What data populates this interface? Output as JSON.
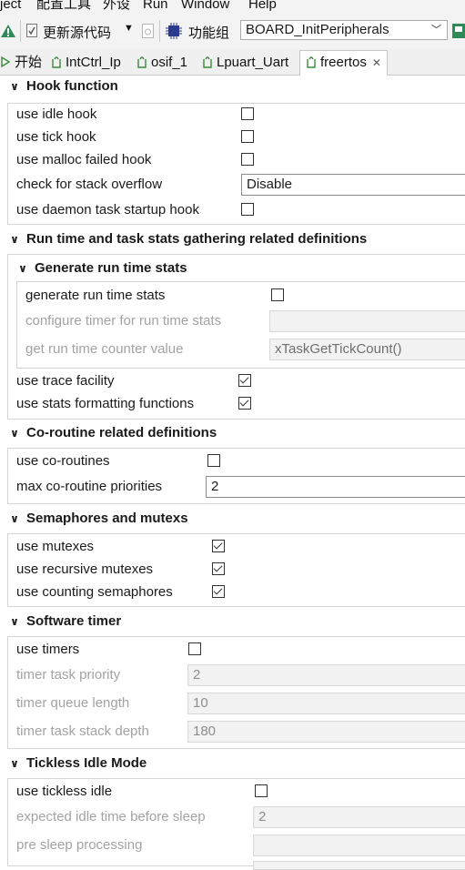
{
  "menubar": {
    "items": [
      "ject",
      "配置工具",
      "外设",
      "Run",
      "Window",
      "Help"
    ]
  },
  "toolbar": {
    "update_source": "更新源代码",
    "function_group": "功能组",
    "board_select": "BOARD_InitPeripherals"
  },
  "tabs": [
    {
      "label": "开始"
    },
    {
      "label": "IntCtrl_Ip"
    },
    {
      "label": "osif_1"
    },
    {
      "label": "Lpuart_Uart"
    },
    {
      "label": "freertos"
    }
  ],
  "sections": {
    "hook": {
      "title": "Hook function",
      "use_idle_hook": "use idle hook",
      "use_tick_hook": "use tick hook",
      "use_malloc_failed_hook": "use malloc failed hook",
      "check_stack_overflow": "check for stack overflow",
      "check_stack_overflow_value": "Disable",
      "use_daemon_hook": "use daemon task startup hook"
    },
    "runtime": {
      "title": "Run time and task stats gathering related definitions",
      "sub_title": "Generate run time stats",
      "generate_stats": "generate run time stats",
      "configure_timer": "configure timer for run time stats",
      "get_counter": "get run time counter value",
      "get_counter_value": "xTaskGetTickCount()",
      "use_trace": "use trace facility",
      "use_stats_format": "use stats formatting functions"
    },
    "coroutine": {
      "title": "Co-routine related definitions",
      "use_coroutines": "use co-routines",
      "max_priorities": "max co-routine priorities",
      "max_priorities_value": "2"
    },
    "semaphores": {
      "title": "Semaphores and mutexs",
      "use_mutexes": "use mutexes",
      "use_recursive": "use recursive mutexes",
      "use_counting": "use counting semaphores"
    },
    "timer": {
      "title": "Software timer",
      "use_timers": "use timers",
      "task_priority": "timer task priority",
      "task_priority_value": "2",
      "queue_length": "timer queue length",
      "queue_length_value": "10",
      "stack_depth": "timer task stack depth",
      "stack_depth_value": "180"
    },
    "tickless": {
      "title": "Tickless Idle Mode",
      "use_tickless": "use tickless idle",
      "expected_idle": "expected idle time before sleep",
      "expected_idle_value": "2",
      "pre_sleep": "pre sleep processing"
    }
  },
  "checkboxes": {
    "use_idle_hook": false,
    "use_tick_hook": false,
    "use_malloc_failed_hook": false,
    "use_daemon_hook": false,
    "generate_stats": false,
    "use_trace": true,
    "use_stats_format": true,
    "use_coroutines": false,
    "use_mutexes": true,
    "use_recursive": true,
    "use_counting": true,
    "use_timers": false,
    "use_tickless": false
  },
  "colors": {
    "warning": "#2e8b57",
    "chip": "#2b3a8c",
    "tab_icon": "#3a8a3a"
  }
}
